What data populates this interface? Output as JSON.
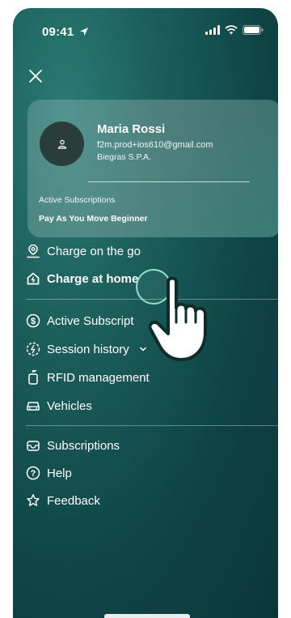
{
  "status": {
    "time": "09:41"
  },
  "profile": {
    "name": "Maria Rossi",
    "email": "f2m.prod+ios610@gmail.com",
    "company": "Biegras S.P.A.",
    "subscriptions_label": "Active Subscriptions",
    "subscription_name": "Pay As You Move Beginner"
  },
  "menu": {
    "charge_on_the_go": "Charge on the go",
    "charge_at_home": "Charge at home",
    "active_subscriptions": "Active Subscript",
    "session_history": "Session history",
    "rfid_management": "RFID management",
    "vehicles": "Vehicles",
    "subscriptions": "Subscriptions",
    "help": "Help",
    "feedback": "Feedback"
  },
  "colors": {
    "background_top": "#2b7a75",
    "background_bottom": "#0b3639",
    "avatar": "#2a3d3b",
    "tap_ring": "#a0ebd2"
  }
}
